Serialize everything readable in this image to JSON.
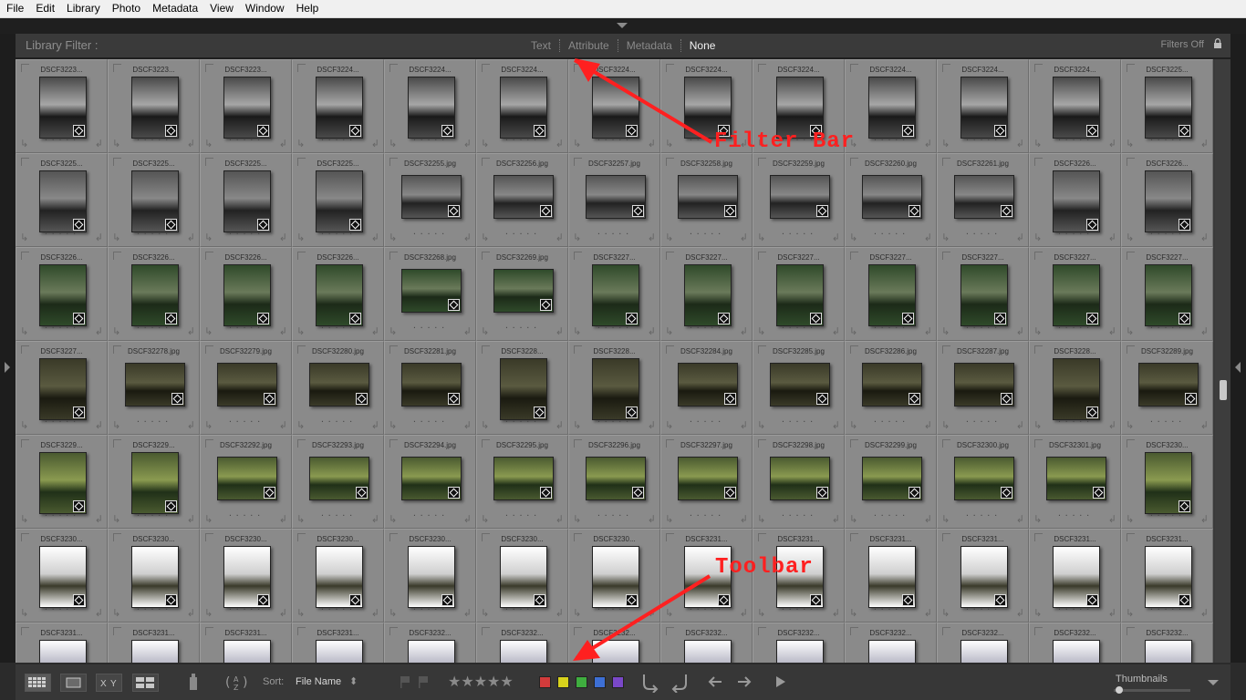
{
  "menu": [
    "File",
    "Edit",
    "Library",
    "Photo",
    "Metadata",
    "View",
    "Window",
    "Help"
  ],
  "filter_bar": {
    "title": "Library Filter :",
    "tabs": [
      "Text",
      "Attribute",
      "Metadata",
      "None"
    ],
    "active_tab": "None",
    "filters_status": "Filters Off"
  },
  "grid": {
    "rows": [
      [
        "DSCF3223...",
        "DSCF3223...",
        "DSCF3223...",
        "DSCF3224...",
        "DSCF3224...",
        "DSCF3224...",
        "DSCF3224...",
        "DSCF3224...",
        "DSCF3224...",
        "DSCF3224...",
        "DSCF3224...",
        "DSCF3224...",
        "DSCF3225..."
      ],
      [
        "DSCF3225...",
        "DSCF3225...",
        "DSCF3225...",
        "DSCF3225...",
        "DSCF32255.jpg",
        "DSCF32256.jpg",
        "DSCF32257.jpg",
        "DSCF32258.jpg",
        "DSCF32259.jpg",
        "DSCF32260.jpg",
        "DSCF32261.jpg",
        "DSCF3226...",
        "DSCF3226..."
      ],
      [
        "DSCF3226...",
        "DSCF3226...",
        "DSCF3226...",
        "DSCF3226...",
        "DSCF32268.jpg",
        "DSCF32269.jpg",
        "DSCF3227...",
        "DSCF3227...",
        "DSCF3227...",
        "DSCF3227...",
        "DSCF3227...",
        "DSCF3227...",
        "DSCF3227..."
      ],
      [
        "DSCF3227...",
        "DSCF32278.jpg",
        "DSCF32279.jpg",
        "DSCF32280.jpg",
        "DSCF32281.jpg",
        "DSCF3228...",
        "DSCF3228...",
        "DSCF32284.jpg",
        "DSCF32285.jpg",
        "DSCF32286.jpg",
        "DSCF32287.jpg",
        "DSCF3228...",
        "DSCF32289.jpg"
      ],
      [
        "DSCF3229...",
        "DSCF3229...",
        "DSCF32292.jpg",
        "DSCF32293.jpg",
        "DSCF32294.jpg",
        "DSCF32295.jpg",
        "DSCF32296.jpg",
        "DSCF32297.jpg",
        "DSCF32298.jpg",
        "DSCF32299.jpg",
        "DSCF32300.jpg",
        "DSCF32301.jpg",
        "DSCF3230..."
      ],
      [
        "DSCF3230...",
        "DSCF3230...",
        "DSCF3230...",
        "DSCF3230...",
        "DSCF3230...",
        "DSCF3230...",
        "DSCF3230...",
        "DSCF3231...",
        "DSCF3231...",
        "DSCF3231...",
        "DSCF3231...",
        "DSCF3231...",
        "DSCF3231..."
      ],
      [
        "DSCF3231...",
        "DSCF3231...",
        "DSCF3231...",
        "DSCF3231...",
        "DSCF3232...",
        "DSCF3232...",
        "DSCF3232...",
        "DSCF3232...",
        "DSCF3232...",
        "DSCF3232...",
        "DSCF3232...",
        "DSCF3232...",
        "DSCF3232..."
      ]
    ]
  },
  "toolbar": {
    "sort_label": "Sort:",
    "sort_value": "File Name",
    "stars": "★★★★★",
    "color_labels": [
      "#d23b3b",
      "#d8d21c",
      "#3fae3f",
      "#3d6fd4",
      "#7a48c8"
    ],
    "thumbnails_label": "Thumbnails",
    "thumbnail_size_fraction": 0.05
  },
  "annotations": {
    "filter_bar": "Filter Bar",
    "toolbar": "Toolbar"
  }
}
